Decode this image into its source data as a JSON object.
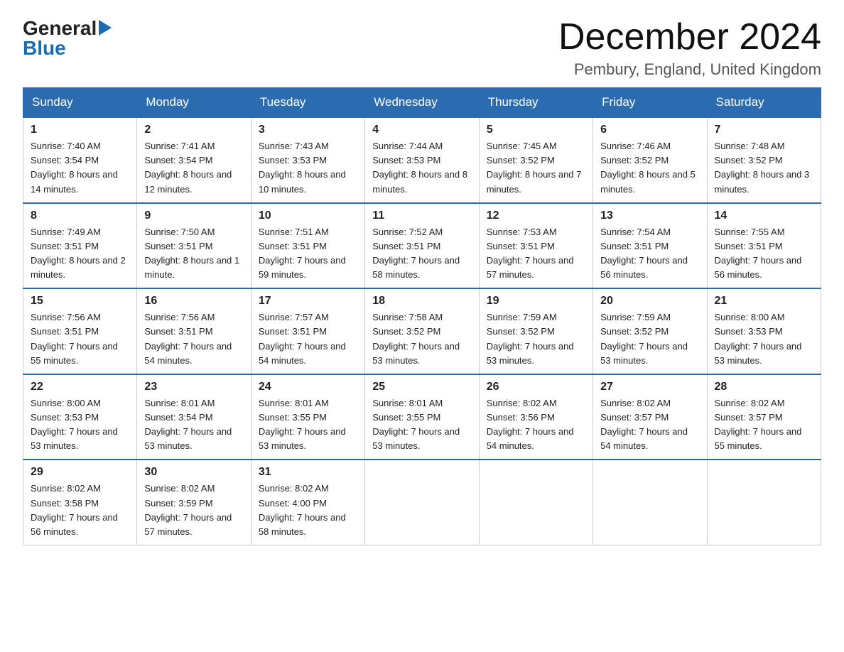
{
  "header": {
    "title": "December 2024",
    "subtitle": "Pembury, England, United Kingdom"
  },
  "logo": {
    "general": "General",
    "blue": "Blue"
  },
  "days_of_week": [
    "Sunday",
    "Monday",
    "Tuesday",
    "Wednesday",
    "Thursday",
    "Friday",
    "Saturday"
  ],
  "weeks": [
    [
      {
        "num": "1",
        "sunrise": "7:40 AM",
        "sunset": "3:54 PM",
        "daylight": "8 hours and 14 minutes."
      },
      {
        "num": "2",
        "sunrise": "7:41 AM",
        "sunset": "3:54 PM",
        "daylight": "8 hours and 12 minutes."
      },
      {
        "num": "3",
        "sunrise": "7:43 AM",
        "sunset": "3:53 PM",
        "daylight": "8 hours and 10 minutes."
      },
      {
        "num": "4",
        "sunrise": "7:44 AM",
        "sunset": "3:53 PM",
        "daylight": "8 hours and 8 minutes."
      },
      {
        "num": "5",
        "sunrise": "7:45 AM",
        "sunset": "3:52 PM",
        "daylight": "8 hours and 7 minutes."
      },
      {
        "num": "6",
        "sunrise": "7:46 AM",
        "sunset": "3:52 PM",
        "daylight": "8 hours and 5 minutes."
      },
      {
        "num": "7",
        "sunrise": "7:48 AM",
        "sunset": "3:52 PM",
        "daylight": "8 hours and 3 minutes."
      }
    ],
    [
      {
        "num": "8",
        "sunrise": "7:49 AM",
        "sunset": "3:51 PM",
        "daylight": "8 hours and 2 minutes."
      },
      {
        "num": "9",
        "sunrise": "7:50 AM",
        "sunset": "3:51 PM",
        "daylight": "8 hours and 1 minute."
      },
      {
        "num": "10",
        "sunrise": "7:51 AM",
        "sunset": "3:51 PM",
        "daylight": "7 hours and 59 minutes."
      },
      {
        "num": "11",
        "sunrise": "7:52 AM",
        "sunset": "3:51 PM",
        "daylight": "7 hours and 58 minutes."
      },
      {
        "num": "12",
        "sunrise": "7:53 AM",
        "sunset": "3:51 PM",
        "daylight": "7 hours and 57 minutes."
      },
      {
        "num": "13",
        "sunrise": "7:54 AM",
        "sunset": "3:51 PM",
        "daylight": "7 hours and 56 minutes."
      },
      {
        "num": "14",
        "sunrise": "7:55 AM",
        "sunset": "3:51 PM",
        "daylight": "7 hours and 56 minutes."
      }
    ],
    [
      {
        "num": "15",
        "sunrise": "7:56 AM",
        "sunset": "3:51 PM",
        "daylight": "7 hours and 55 minutes."
      },
      {
        "num": "16",
        "sunrise": "7:56 AM",
        "sunset": "3:51 PM",
        "daylight": "7 hours and 54 minutes."
      },
      {
        "num": "17",
        "sunrise": "7:57 AM",
        "sunset": "3:51 PM",
        "daylight": "7 hours and 54 minutes."
      },
      {
        "num": "18",
        "sunrise": "7:58 AM",
        "sunset": "3:52 PM",
        "daylight": "7 hours and 53 minutes."
      },
      {
        "num": "19",
        "sunrise": "7:59 AM",
        "sunset": "3:52 PM",
        "daylight": "7 hours and 53 minutes."
      },
      {
        "num": "20",
        "sunrise": "7:59 AM",
        "sunset": "3:52 PM",
        "daylight": "7 hours and 53 minutes."
      },
      {
        "num": "21",
        "sunrise": "8:00 AM",
        "sunset": "3:53 PM",
        "daylight": "7 hours and 53 minutes."
      }
    ],
    [
      {
        "num": "22",
        "sunrise": "8:00 AM",
        "sunset": "3:53 PM",
        "daylight": "7 hours and 53 minutes."
      },
      {
        "num": "23",
        "sunrise": "8:01 AM",
        "sunset": "3:54 PM",
        "daylight": "7 hours and 53 minutes."
      },
      {
        "num": "24",
        "sunrise": "8:01 AM",
        "sunset": "3:55 PM",
        "daylight": "7 hours and 53 minutes."
      },
      {
        "num": "25",
        "sunrise": "8:01 AM",
        "sunset": "3:55 PM",
        "daylight": "7 hours and 53 minutes."
      },
      {
        "num": "26",
        "sunrise": "8:02 AM",
        "sunset": "3:56 PM",
        "daylight": "7 hours and 54 minutes."
      },
      {
        "num": "27",
        "sunrise": "8:02 AM",
        "sunset": "3:57 PM",
        "daylight": "7 hours and 54 minutes."
      },
      {
        "num": "28",
        "sunrise": "8:02 AM",
        "sunset": "3:57 PM",
        "daylight": "7 hours and 55 minutes."
      }
    ],
    [
      {
        "num": "29",
        "sunrise": "8:02 AM",
        "sunset": "3:58 PM",
        "daylight": "7 hours and 56 minutes."
      },
      {
        "num": "30",
        "sunrise": "8:02 AM",
        "sunset": "3:59 PM",
        "daylight": "7 hours and 57 minutes."
      },
      {
        "num": "31",
        "sunrise": "8:02 AM",
        "sunset": "4:00 PM",
        "daylight": "7 hours and 58 minutes."
      },
      null,
      null,
      null,
      null
    ]
  ],
  "labels": {
    "sunrise": "Sunrise:",
    "sunset": "Sunset:",
    "daylight": "Daylight:"
  }
}
